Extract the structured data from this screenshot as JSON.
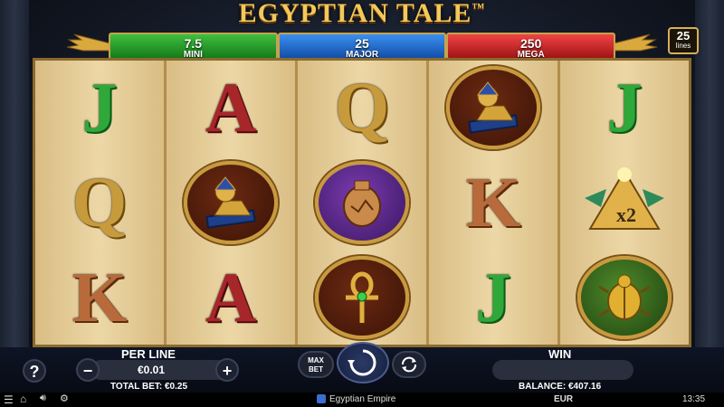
{
  "game": {
    "title": "EGYPTIAN TALE",
    "tm": "™"
  },
  "jackpots": {
    "mini": {
      "value": "7.5",
      "label": "MINI"
    },
    "major": {
      "value": "25",
      "label": "MAJOR"
    },
    "mega": {
      "value": "250",
      "label": "MEGA"
    }
  },
  "lines": {
    "count": "25",
    "label": "lines"
  },
  "reels": [
    [
      "J",
      "Q",
      "K"
    ],
    [
      "A",
      "sphinx",
      "A"
    ],
    [
      "Q",
      "vase",
      "ankh"
    ],
    [
      "sphinx",
      "K",
      "J"
    ],
    [
      "J",
      "pyramid-x2",
      "scarab"
    ]
  ],
  "pyramid_multiplier": "x2",
  "controls": {
    "help_label": "?",
    "per_line_label": "PER LINE",
    "per_line_value": "€0.01",
    "minus_label": "−",
    "plus_label": "+",
    "max_bet_label_line1": "MAX",
    "max_bet_label_line2": "BET",
    "win_label": "WIN",
    "win_value": "",
    "total_bet": "TOTAL BET: €0.25",
    "balance": "BALANCE: €407.16"
  },
  "footer": {
    "brand": "Egyptian Empire",
    "currency": "EUR",
    "clock": "13:35"
  },
  "colors": {
    "mini": "#2a9a2a",
    "major": "#1f6fd0",
    "mega": "#d02020",
    "gold": "#f3c85a"
  }
}
